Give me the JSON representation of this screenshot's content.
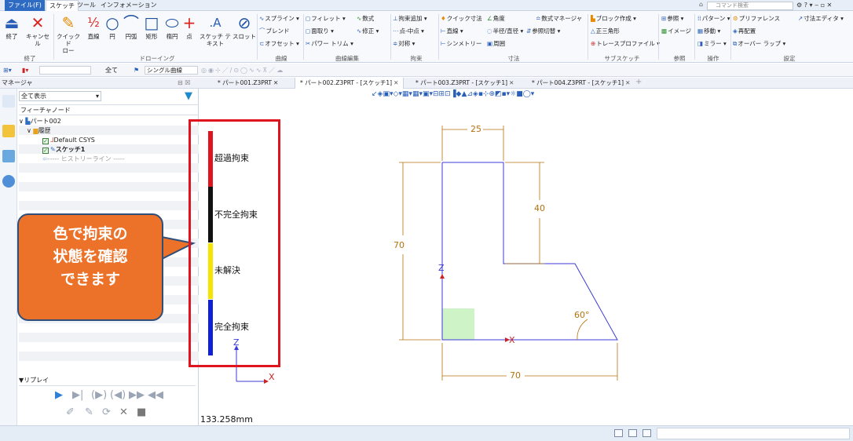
{
  "menu": {
    "file": "ファイル(F)",
    "tabs": [
      "スケッチ",
      "ツール",
      "インフォメーション"
    ],
    "search_placeholder": "コマンド検索"
  },
  "ribbon": {
    "big_buttons": [
      {
        "label": "終了",
        "icon": "exit-icon"
      },
      {
        "label": "キャンセル",
        "icon": "cancel-icon"
      },
      {
        "label": "クイックド",
        "label2": "ロー",
        "icon": "quick-draw-icon"
      },
      {
        "label": "直線",
        "icon": "line-icon"
      },
      {
        "label": "円",
        "icon": "circle-icon"
      },
      {
        "label": "円弧",
        "icon": "arc-icon"
      },
      {
        "label": "矩形",
        "icon": "rectangle-icon"
      },
      {
        "label": "楕円",
        "icon": "ellipse-icon"
      },
      {
        "label": "点",
        "icon": "point-icon"
      },
      {
        "label": "スケッチ テ",
        "label2": "キスト",
        "icon": "sketch-text-icon"
      },
      {
        "label": "スロット",
        "icon": "slot-icon"
      }
    ],
    "curve_items": [
      "スプライン",
      "ブレンド",
      "オフセット"
    ],
    "curve_edit_items": [
      "フィレット",
      "面取り",
      "パワー トリム",
      "数式",
      "修正"
    ],
    "constraint_items": [
      "拘束追加",
      "点-中点",
      "対称"
    ],
    "dimension_items": [
      "クイック寸法",
      "角度",
      "直線",
      "半径/直径",
      "参照切替",
      "シンメトリー",
      "周囲"
    ],
    "subsketch_items": [
      "数式マネージャ",
      "ブロック作成",
      "正三角形",
      "トレースプロファイル"
    ],
    "reference_items": [
      "参照",
      "イメージ"
    ],
    "operation_items": [
      "パターン",
      "移動",
      "ミラー"
    ],
    "settings_items": [
      "プリファレンス",
      "再配置",
      "オーバー ラップ",
      "寸法エディタ"
    ],
    "groups": [
      "終了",
      "ドローイング",
      "曲線",
      "曲線編集",
      "拘束",
      "寸法",
      "サブスケッチ",
      "参照",
      "操作",
      "設定"
    ]
  },
  "toolbar2": {
    "filter_all": "全て",
    "curve_mode": "シングル曲線"
  },
  "manager": {
    "title": "マネージャ",
    "filter_value": "全て表示",
    "tree_header": "フィーチャノード",
    "nodes": [
      {
        "label": "パート002",
        "indent": 0
      },
      {
        "label": "履歴",
        "indent": 1
      },
      {
        "label": "Default CSYS",
        "indent": 2
      },
      {
        "label": "スケッチ1",
        "indent": 2
      },
      {
        "label": "----- ヒストリーライン -----",
        "indent": 2
      }
    ],
    "replay_label": "▼リプレイ"
  },
  "callout": {
    "lines": [
      "色で拘束の",
      "状態を確認",
      "できます"
    ]
  },
  "doc_tabs": [
    {
      "label": "* パート001.Z3PRT",
      "active": false
    },
    {
      "label": "* パート002.Z3PRT - [スケッチ1]",
      "active": true
    },
    {
      "label": "* パート003.Z3PRT - [スケッチ1]",
      "active": false
    },
    {
      "label": "* パート004.Z3PRT - [スケッチ1]",
      "active": false
    }
  ],
  "legend": [
    {
      "label": "超過拘束",
      "color": "#e0141e"
    },
    {
      "label": "不完全拘束",
      "color": "#111111"
    },
    {
      "label": "未解決",
      "color": "#f4e400"
    },
    {
      "label": "完全拘束",
      "color": "#1020d8"
    }
  ],
  "sketch": {
    "dimensions": {
      "top_width": "25",
      "right_height": "40",
      "total_height": "70",
      "bottom_width": "70",
      "angle": "60°"
    },
    "axis_z": "Z",
    "axis_x": "X"
  },
  "measure": "133.258mm",
  "colors": {
    "accent": "#2e6cc4",
    "dimension": "#b5720f",
    "geometry": "#3b3bd8",
    "callout": "#ec7229"
  }
}
